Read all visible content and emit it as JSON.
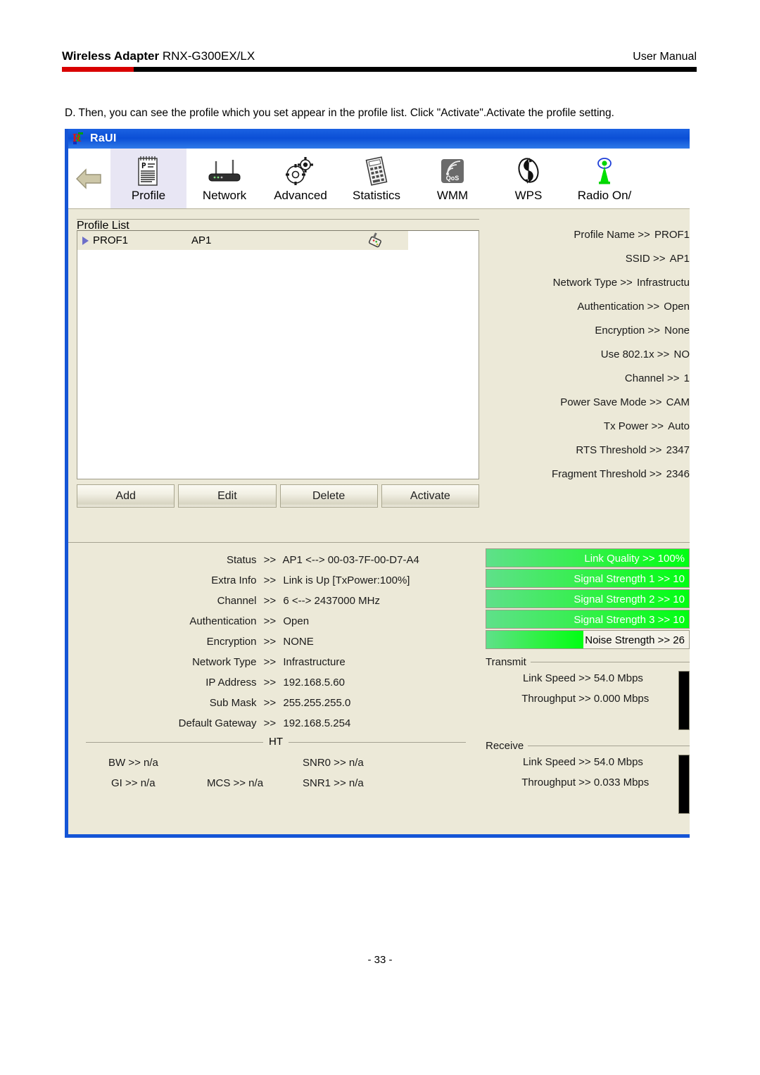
{
  "document": {
    "header_left_bold": "Wireless Adapter",
    "header_left_model": "RNX-G300EX/LX",
    "header_right": "User Manual",
    "instruction": "D. Then, you can see the profile which you set appear in the profile list. Click \"Activate\".Activate the profile setting.",
    "page_number": "- 33 -",
    "accent_red": "#d90000",
    "rule_black": "#000000"
  },
  "app": {
    "title": "RaUI",
    "titlebar_color": "#0b4fd6",
    "window_border_color": "#1555d6",
    "panel_color": "#ece9d8",
    "toolbar": {
      "back_icon": "back-arrow-icon",
      "tabs": [
        {
          "label": "Profile",
          "icon": "profile-notepad-icon",
          "active": true
        },
        {
          "label": "Network",
          "icon": "router-icon",
          "active": false
        },
        {
          "label": "Advanced",
          "icon": "gears-icon",
          "active": false
        },
        {
          "label": "Statistics",
          "icon": "calculator-icon",
          "active": false
        },
        {
          "label": "WMM",
          "icon": "qos-signal-icon",
          "active": false
        },
        {
          "label": "WPS",
          "icon": "wps-arrows-icon",
          "active": false
        },
        {
          "label": "Radio On/",
          "icon": "antenna-icon",
          "active": false
        }
      ]
    },
    "profile_list": {
      "caption": "Profile List",
      "rows": [
        {
          "marker": "active-triangle-icon",
          "name": "PROF1",
          "ssid": "AP1",
          "status_icon": "wireless-dongle-icon"
        }
      ],
      "buttons": [
        "Add",
        "Edit",
        "Delete",
        "Activate"
      ]
    },
    "profile_details": [
      {
        "label": "Profile Name",
        "sep": ">>",
        "value": "PROF1"
      },
      {
        "label": "SSID",
        "sep": ">>",
        "value": "AP1"
      },
      {
        "label": "Network Type",
        "sep": ">>",
        "value": "Infrastructu"
      },
      {
        "label": "Authentication",
        "sep": ">>",
        "value": "Open"
      },
      {
        "label": "Encryption",
        "sep": ">>",
        "value": "None"
      },
      {
        "label": "Use 802.1x",
        "sep": ">>",
        "value": "NO"
      },
      {
        "label": "Channel",
        "sep": ">>",
        "value": "1"
      },
      {
        "label": "Power Save Mode",
        "sep": ">>",
        "value": "CAM"
      },
      {
        "label": "Tx Power",
        "sep": ">>",
        "value": "Auto"
      },
      {
        "label": "RTS Threshold",
        "sep": ">>",
        "value": "2347"
      },
      {
        "label": "Fragment Threshold",
        "sep": ">>",
        "value": "2346"
      }
    ],
    "status": [
      {
        "label": "Status",
        "sep": ">>",
        "value": "AP1 <--> 00-03-7F-00-D7-A4"
      },
      {
        "label": "Extra Info",
        "sep": ">>",
        "value": "Link is Up [TxPower:100%]"
      },
      {
        "label": "Channel",
        "sep": ">>",
        "value": "6 <--> 2437000 MHz"
      },
      {
        "label": "Authentication",
        "sep": ">>",
        "value": "Open"
      },
      {
        "label": "Encryption",
        "sep": ">>",
        "value": "NONE"
      },
      {
        "label": "Network Type",
        "sep": ">>",
        "value": "Infrastructure"
      },
      {
        "label": "IP Address",
        "sep": ">>",
        "value": "192.168.5.60"
      },
      {
        "label": "Sub Mask",
        "sep": ">>",
        "value": "255.255.255.0"
      },
      {
        "label": "Default Gateway",
        "sep": ">>",
        "value": "192.168.5.254"
      }
    ],
    "ht": {
      "caption": "HT",
      "bw": "BW >> n/a",
      "gi": "GI >> n/a",
      "mcs": "MCS >> n/a",
      "snr0": "SNR0 >> n/a",
      "snr1": "SNR1 >> n/a"
    },
    "signal_bars": [
      {
        "text": "Link Quality >> 100%",
        "percent": 100,
        "text_color": "light"
      },
      {
        "text": "Signal Strength 1 >> 10",
        "percent": 100,
        "text_color": "light"
      },
      {
        "text": "Signal Strength 2 >> 10",
        "percent": 100,
        "text_color": "light"
      },
      {
        "text": "Signal Strength 3 >> 10",
        "percent": 100,
        "text_color": "light"
      },
      {
        "text": "Noise Strength >> 26",
        "percent": 48,
        "text_color": "dark"
      }
    ],
    "transmit": {
      "caption": "Transmit",
      "link_speed_label": "Link Speed",
      "link_speed_value": "54.0 Mbps",
      "throughput_label": "Throughput",
      "throughput_value": "0.000 Mbps",
      "sep": ">>"
    },
    "receive": {
      "caption": "Receive",
      "link_speed_label": "Link Speed",
      "link_speed_value": "54.0 Mbps",
      "throughput_label": "Throughput",
      "throughput_value": "0.033 Mbps",
      "sep": ">>"
    }
  }
}
